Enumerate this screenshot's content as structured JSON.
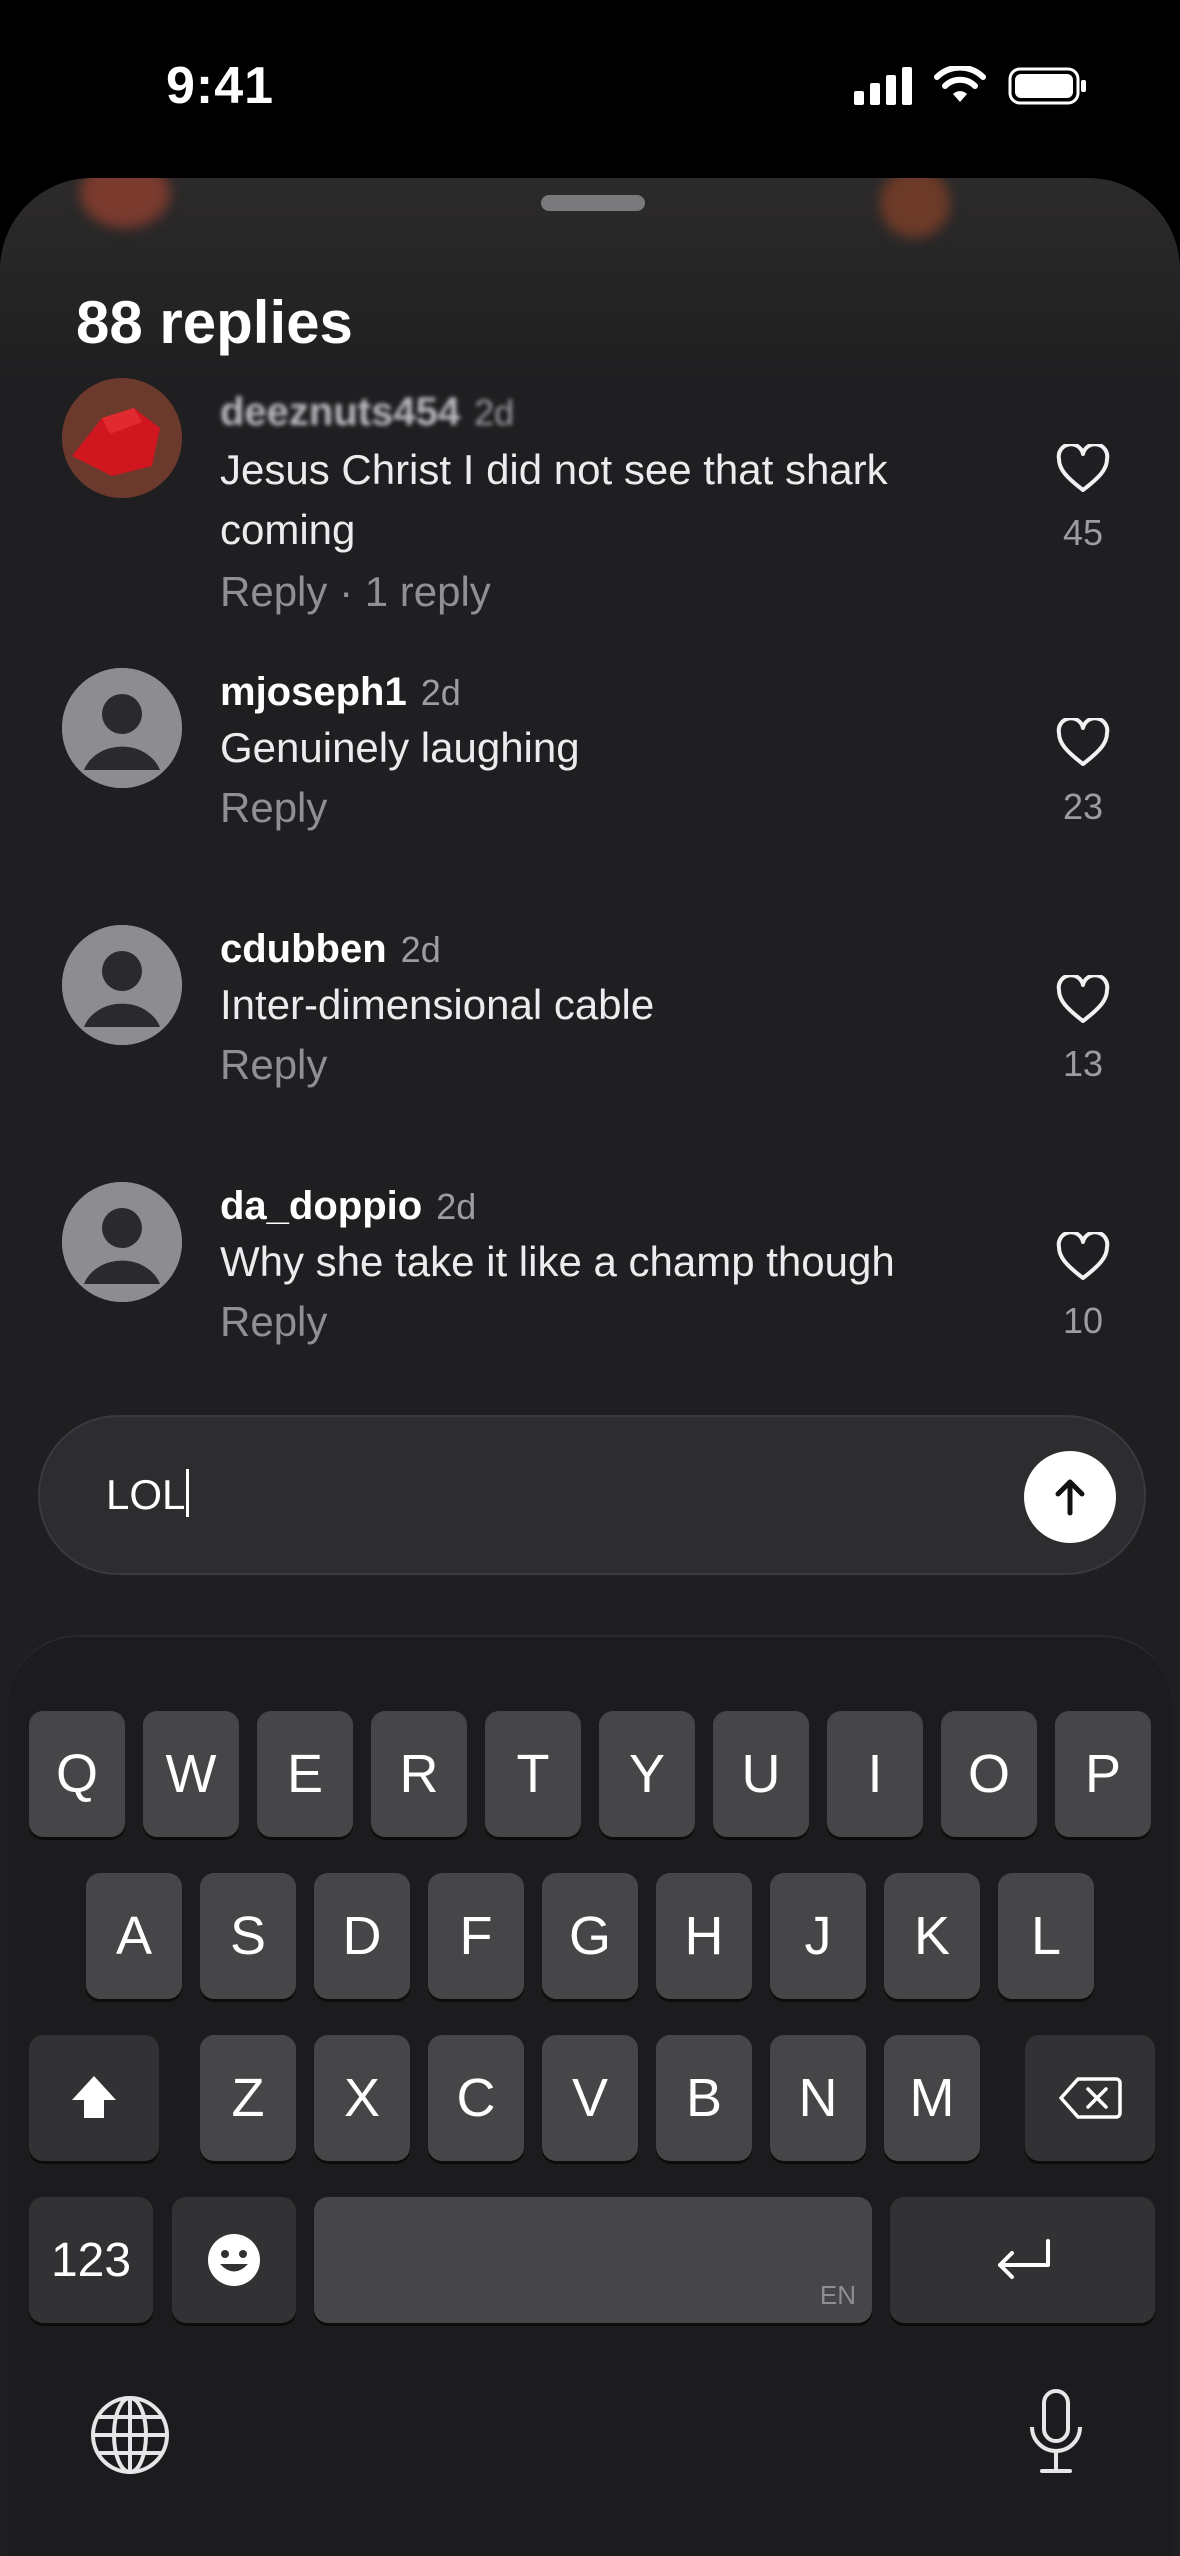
{
  "status_bar": {
    "time": "9:41"
  },
  "sheet": {
    "title": "88 replies"
  },
  "comments": [
    {
      "username": "deeznuts454",
      "time": "2d",
      "text": "Jesus Christ I did not see that shark coming",
      "reply_label": "Reply",
      "reply_count": "1 reply",
      "likes": "45",
      "avatar": "custom-red-avatar"
    },
    {
      "username": "mjoseph1",
      "time": "2d",
      "text": "Genuinely laughing",
      "reply_label": "Reply",
      "likes": "23",
      "avatar": "default-person-icon"
    },
    {
      "username": "cdubben",
      "time": "2d",
      "text": "Inter-dimensional cable",
      "reply_label": "Reply",
      "likes": "13",
      "avatar": "default-person-icon"
    },
    {
      "username": "da_doppio",
      "time": "2d",
      "text": "Why she take it like a champ though",
      "reply_label": "Reply",
      "likes": "10",
      "avatar": "default-person-icon"
    }
  ],
  "composer": {
    "value": "LOL",
    "send_icon": "arrow-up-icon"
  },
  "keyboard": {
    "row1": [
      "Q",
      "W",
      "E",
      "R",
      "T",
      "Y",
      "U",
      "I",
      "O",
      "P"
    ],
    "row2": [
      "A",
      "S",
      "D",
      "F",
      "G",
      "H",
      "J",
      "K",
      "L"
    ],
    "row3": [
      "Z",
      "X",
      "C",
      "V",
      "B",
      "N",
      "M"
    ],
    "numbers_label": "123",
    "space_language": "EN",
    "icons": [
      "shift-icon",
      "backspace-icon",
      "emoji-icon",
      "return-icon",
      "globe-icon",
      "microphone-icon"
    ]
  },
  "colors": {
    "background": "#1f1f21",
    "key": "#464649",
    "key_dark": "#323235",
    "muted_text": "#9d9da1"
  }
}
